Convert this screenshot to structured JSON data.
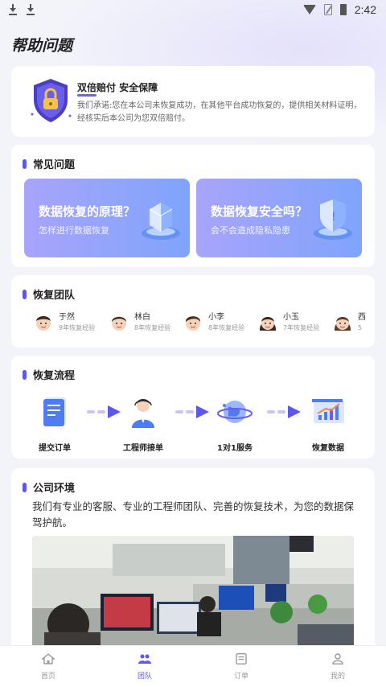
{
  "status_bar": {
    "time": "2:42"
  },
  "page": {
    "title": "帮助问题"
  },
  "guarantee": {
    "title": "双倍赔付 安全保障",
    "description": "我们承诺:您在本公司未恢复成功，在其他平台成功恢复的，提供相关材料证明，经核实后本公司为您双倍赔付。"
  },
  "faq": {
    "heading": "常见问题",
    "items": [
      {
        "question": "数据恢复的原理？",
        "subtitle": "怎样进行数据恢复"
      },
      {
        "question": "数据恢复安全吗？",
        "subtitle": "会不会造成隐私隐患"
      }
    ]
  },
  "team": {
    "heading": "恢复团队",
    "members": [
      {
        "name": "于然",
        "experience": "9年恢复经验"
      },
      {
        "name": "林白",
        "experience": "8年恢复经验"
      },
      {
        "name": "小李",
        "experience": "8年恢复经验"
      },
      {
        "name": "小玉",
        "experience": "7年恢复经验"
      },
      {
        "name": "西",
        "experience": "5"
      }
    ]
  },
  "process": {
    "heading": "恢复流程",
    "steps": [
      {
        "label": "提交订单"
      },
      {
        "label": "工程师接单"
      },
      {
        "label": "1对1服务"
      },
      {
        "label": "恢复数据"
      }
    ]
  },
  "company": {
    "heading": "公司环境",
    "description": "我们有专业的客服、专业的工程师团队、完善的恢复技术，为您的数据保驾护航。"
  },
  "bottom_nav": {
    "items": [
      {
        "label": "首页",
        "icon": "home-icon"
      },
      {
        "label": "团队",
        "icon": "team-icon",
        "active": true
      },
      {
        "label": "订单",
        "icon": "order-icon"
      },
      {
        "label": "我的",
        "icon": "profile-icon"
      }
    ]
  },
  "colors": {
    "accent": "#5b57ef",
    "tile_gradient_start": "#a8a4fb",
    "tile_gradient_end": "#7fa4fb"
  }
}
